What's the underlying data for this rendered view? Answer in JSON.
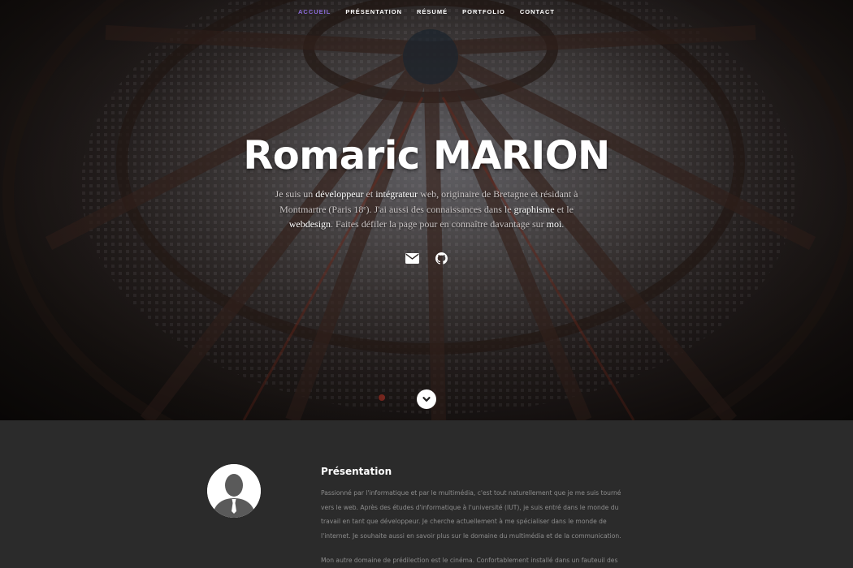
{
  "nav": {
    "items": [
      {
        "label": "ACCUEIL",
        "active": true
      },
      {
        "label": "PRÉSENTATION",
        "active": false
      },
      {
        "label": "RÉSUMÉ",
        "active": false
      },
      {
        "label": "PORTFOLIO",
        "active": false
      },
      {
        "label": "CONTACT",
        "active": false
      }
    ],
    "active_color": "#8a6bd8"
  },
  "hero": {
    "title": "Romaric MARION",
    "intro": {
      "t1": "Je suis un ",
      "k1": "développeur",
      "t2": " et ",
      "k2": "intégrateur",
      "t3": " web, originaire de Bretagne et résidant à Montmartre (Paris 18ᵉ). J'ai aussi des connaissances dans le ",
      "k3": "graphisme",
      "t4": " et le ",
      "k4": "webdesign",
      "t5": ". Faites défiler la page pour en connaître davantage sur ",
      "k5": "moi",
      "t6": "."
    },
    "social": [
      {
        "icon": "envelope-icon"
      },
      {
        "icon": "github-icon"
      }
    ],
    "scroll_icon": "chevron-down-icon"
  },
  "about": {
    "title": "Présentation",
    "p1": "Passionné par l'informatique et par le multimédia, c'est tout naturellement que je me suis tourné vers le web. Après des études d'informatique à l'université (IUT), je suis entré dans le monde du travail en tant que développeur. Je cherche actuellement à me spécialiser dans le monde de l'internet. Je souhaite aussi en savoir plus sur le domaine du multimédia et de la communication.",
    "p2": "Mon autre domaine de prédilection est le cinéma. Confortablement installé dans un fauteuil des"
  }
}
